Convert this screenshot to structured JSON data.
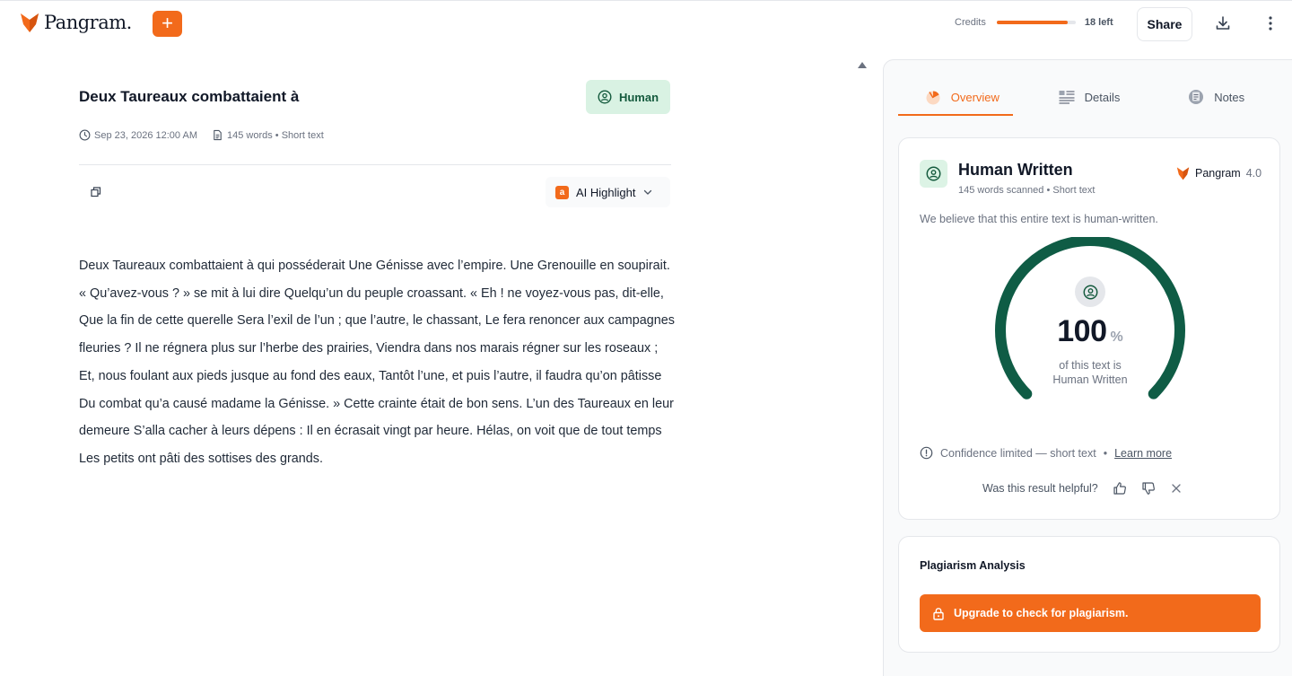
{
  "header": {
    "brand": "Pangram.",
    "add_label": "+",
    "credits_label": "Credits",
    "credits_fill": 0.9,
    "credits_left": "18 left",
    "share_label": "Share"
  },
  "document": {
    "title": "Deux Taureaux combattaient à",
    "badge": "Human",
    "date": "Sep 23, 2026 12:00 AM",
    "words_info": "145 words • Short text",
    "highlight_label": "AI Highlight",
    "highlight_icon_letter": "a",
    "body": "Deux Taureaux combattaient à qui posséderait Une Génisse avec l’empire.   Une Grenouille en soupirait. « Qu’avez-vous ? » se mit à lui dire   Quelqu’un du peuple croassant. « Eh ! ne voyez-vous pas, dit-elle, Que la fin de cette querelle Sera l’exil de l’un ; que l’autre, le chassant, Le fera renoncer aux campagnes fleuries ? Il ne régnera plus sur l’herbe des prairies, Viendra dans nos marais régner sur les roseaux ; Et, nous foulant aux pieds jusque au fond des eaux, Tantôt l’une, et puis l’autre, il faudra qu’on pâtisse Du combat qu’a causé madame la Génisse. » Cette crainte était de bon sens. L’un des Taureaux en leur demeure S’alla cacher à leurs dépens : Il en écrasait vingt par heure. Hélas, on voit que de tout temps Les petits ont pâti des sottises des grands."
  },
  "panel": {
    "tabs": [
      {
        "label": "Overview",
        "icon": "overview-icon"
      },
      {
        "label": "Details",
        "icon": "details-icon"
      },
      {
        "label": "Notes",
        "icon": "notes-icon"
      }
    ],
    "result": {
      "title": "Human Written",
      "subtitle": "145 words scanned • Short text",
      "brand": "Pangram",
      "version": "4.0",
      "belief": "We believe that this entire text is human-written.",
      "percent": "100",
      "percent_value": 1.0,
      "percent_symbol": "%",
      "caption_line1": "of this text is",
      "caption_line2": "Human Written",
      "confidence": "Confidence limited — short text",
      "dot": "•",
      "learn_more": "Learn more",
      "helpful_question": "Was this result helpful?"
    },
    "plagiarism": {
      "title": "Plagiarism Analysis",
      "button_label": "Upgrade to check for plagiarism."
    }
  },
  "colors": {
    "accent": "#f26a1b",
    "human_green": "#145a3d",
    "human_bg": "#d9f2e3"
  }
}
